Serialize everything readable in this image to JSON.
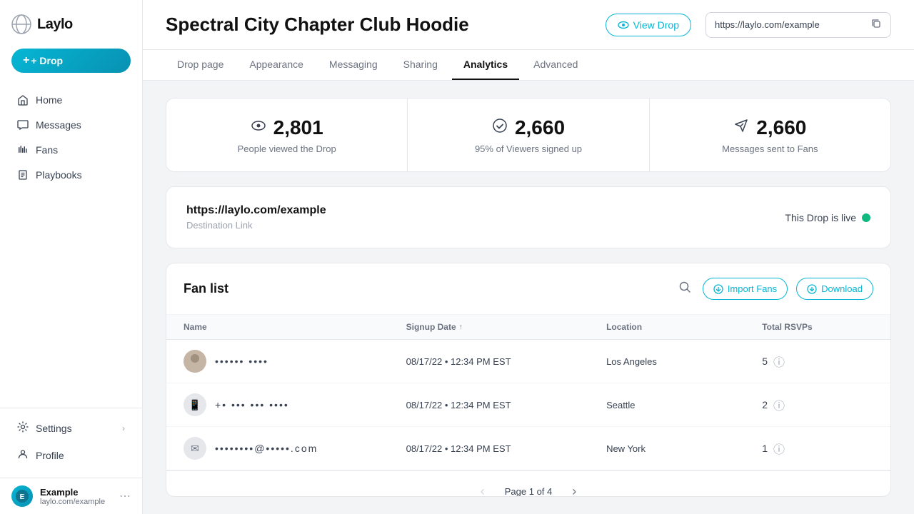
{
  "brand": {
    "name": "Laylo"
  },
  "sidebar": {
    "drop_button": "+ Drop",
    "nav_items": [
      {
        "id": "home",
        "label": "Home",
        "icon": "home"
      },
      {
        "id": "messages",
        "label": "Messages",
        "icon": "messages"
      },
      {
        "id": "fans",
        "label": "Fans",
        "icon": "fans"
      },
      {
        "id": "playbooks",
        "label": "Playbooks",
        "icon": "playbooks"
      }
    ],
    "settings": {
      "label": "Settings"
    },
    "profile": {
      "label": "Profile"
    },
    "account": {
      "name": "Example",
      "url": "laylo.com/example"
    }
  },
  "header": {
    "title": "Spectral City Chapter Club Hoodie",
    "view_drop_label": "View Drop",
    "url": "https://laylo.com/example"
  },
  "tabs": [
    {
      "id": "drop-page",
      "label": "Drop page"
    },
    {
      "id": "appearance",
      "label": "Appearance"
    },
    {
      "id": "messaging",
      "label": "Messaging"
    },
    {
      "id": "sharing",
      "label": "Sharing"
    },
    {
      "id": "analytics",
      "label": "Analytics",
      "active": true
    },
    {
      "id": "advanced",
      "label": "Advanced"
    }
  ],
  "stats": [
    {
      "id": "views",
      "icon": "eye",
      "number": "2,801",
      "label": "People viewed the Drop"
    },
    {
      "id": "signups",
      "icon": "check-circle",
      "number": "2,660",
      "label": "95% of Viewers signed up"
    },
    {
      "id": "messages",
      "icon": "send",
      "number": "2,660",
      "label": "Messages sent to Fans"
    }
  ],
  "link_section": {
    "url": "https://laylo.com/example",
    "label": "Destination Link",
    "status": "This Drop is live"
  },
  "fan_list": {
    "title": "Fan list",
    "import_label": "Import Fans",
    "download_label": "Download",
    "columns": [
      {
        "id": "name",
        "label": "Name"
      },
      {
        "id": "signup_date",
        "label": "Signup Date",
        "sortable": true
      },
      {
        "id": "location",
        "label": "Location"
      },
      {
        "id": "total_rsvps",
        "label": "Total RSVPs"
      }
    ],
    "rows": [
      {
        "id": 1,
        "name": "•••••• ••••",
        "avatar_type": "person",
        "signup_date": "08/17/22 • 12:34 PM EST",
        "location": "Los Angeles",
        "total_rsvps": 5
      },
      {
        "id": 2,
        "name": "+• ••• ••• ••••",
        "avatar_type": "phone",
        "signup_date": "08/17/22 • 12:34 PM EST",
        "location": "Seattle",
        "total_rsvps": 2
      },
      {
        "id": 3,
        "name": "••••••••@•••••.com",
        "avatar_type": "email",
        "signup_date": "08/17/22 • 12:34 PM EST",
        "location": "New York",
        "total_rsvps": 1
      }
    ],
    "pagination": {
      "current_page": 1,
      "total_pages": 4,
      "label": "Page 1 of 4"
    }
  }
}
